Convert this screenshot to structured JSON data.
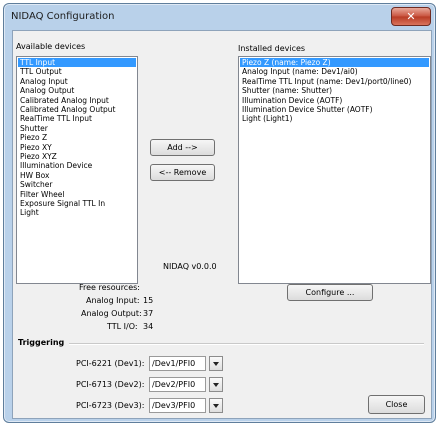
{
  "window": {
    "title": "NIDAQ Configuration"
  },
  "available": {
    "header": "Available devices",
    "items": [
      "TTL Input",
      "TTL Output",
      "Analog Input",
      "Analog Output",
      "Calibrated Analog Input",
      "Calibrated Analog Output",
      "RealTime TTL Input",
      "Shutter",
      "Piezo Z",
      "Piezo XY",
      "Piezo XYZ",
      "Illumination Device",
      "HW Box",
      "Switcher",
      "Filter Wheel",
      "Exposure Signal TTL In",
      "Light"
    ],
    "selected_index": 0
  },
  "installed": {
    "header": "Installed devices",
    "items": [
      "Piezo Z (name: Piezo Z)",
      "Analog Input (name: Dev1/ai0)",
      "RealTime TTL Input (name: Dev1/port0/line0)",
      "Shutter (name: Shutter)",
      "Illumination Device (AOTF)",
      "Illumination Device Shutter (AOTF)",
      "Light (Light1)"
    ],
    "selected_index": 0
  },
  "buttons": {
    "add": "Add -->",
    "remove": "<-- Remove",
    "configure": "Configure ...",
    "close": "Close"
  },
  "version": "NIDAQ v0.0.0",
  "resources": {
    "header": "Free resources:",
    "analog_input_label": "Analog Input:",
    "analog_input_value": "15",
    "analog_output_label": "Analog Output:",
    "analog_output_value": "37",
    "ttl_label": "TTL I/O:",
    "ttl_value": "34"
  },
  "triggering": {
    "header": "Triggering",
    "rows": [
      {
        "label": "PCI-6221 (Dev1):",
        "value": "/Dev1/PFI0"
      },
      {
        "label": "PCI-6713 (Dev2):",
        "value": "/Dev2/PFI0"
      },
      {
        "label": "PCI-6723 (Dev3):",
        "value": "/Dev3/PFI0"
      }
    ]
  },
  "icons": {
    "close": "close-icon",
    "dropdown": "chevron-down-icon"
  },
  "colors": {
    "selection": "#3399ff",
    "close_button": "#c8523d",
    "frame": "#b9d1ea"
  }
}
